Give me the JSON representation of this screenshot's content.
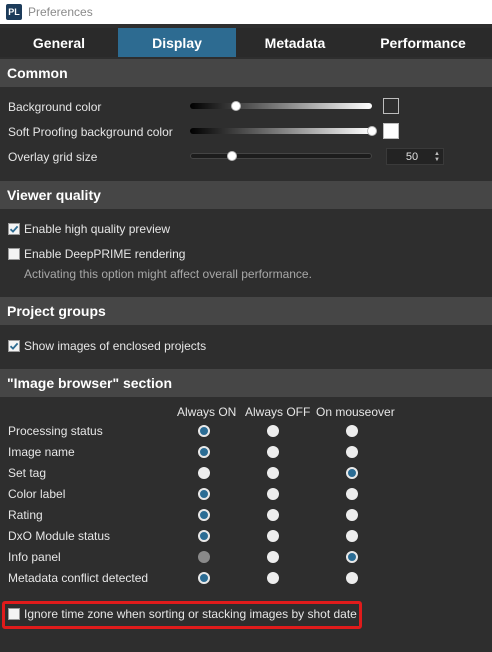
{
  "window": {
    "logo": "PL",
    "title": "Preferences"
  },
  "tabs": [
    {
      "label": "General",
      "active": false
    },
    {
      "label": "Display",
      "active": true
    },
    {
      "label": "Metadata",
      "active": false
    },
    {
      "label": "Performance",
      "active": false
    }
  ],
  "common": {
    "header": "Common",
    "background_color": {
      "label": "Background color",
      "level": 0.25,
      "swatch": "#2e2e2e"
    },
    "soft_proofing": {
      "label": "Soft Proofing background color",
      "level": 1.0,
      "swatch": "#ffffff"
    },
    "overlay_grid": {
      "label": "Overlay grid size",
      "value": "50",
      "level": 0.23
    }
  },
  "viewer_quality": {
    "header": "Viewer quality",
    "high_quality": {
      "label": "Enable high quality preview",
      "checked": true
    },
    "deepprime": {
      "label": "Enable DeepPRIME rendering",
      "checked": false
    },
    "hint": "Activating this option might affect overall performance."
  },
  "project_groups": {
    "header": "Project groups",
    "show_enclosed": {
      "label": "Show images of enclosed projects",
      "checked": true
    }
  },
  "image_browser": {
    "header": "\"Image browser\" section",
    "columns": [
      "Always ON",
      "Always OFF",
      "On mouseover"
    ],
    "rows": [
      {
        "label": "Processing status",
        "selected": 0
      },
      {
        "label": "Image name",
        "selected": 0
      },
      {
        "label": "Set tag",
        "selected": 2
      },
      {
        "label": "Color label",
        "selected": 0
      },
      {
        "label": "Rating",
        "selected": 0
      },
      {
        "label": "DxO Module status",
        "selected": 0
      },
      {
        "label": "Info panel",
        "selected": 2,
        "disabled_option": 0
      },
      {
        "label": "Metadata conflict detected",
        "selected": 0
      }
    ],
    "ignore_timezone": {
      "label": "Ignore time zone when sorting or stacking images by shot date",
      "checked": false
    }
  },
  "colors": {
    "accent": "#2d6b91",
    "highlight": "#e01b1b"
  }
}
